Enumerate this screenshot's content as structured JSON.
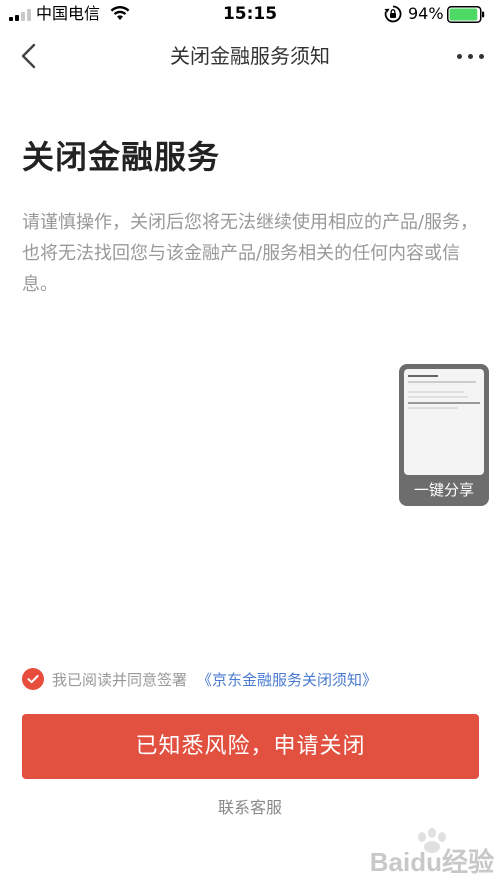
{
  "status_bar": {
    "carrier": "中国电信",
    "time": "15:15",
    "battery_percent": "94%",
    "battery_level": 0.94,
    "icons": [
      "signal-icon",
      "wifi-icon",
      "orientation-lock-icon",
      "battery-icon"
    ]
  },
  "nav": {
    "title": "关闭金融服务须知",
    "back_icon": "chevron-left-icon",
    "more_icon": "more-dots-icon"
  },
  "main": {
    "title": "关闭金融服务",
    "description": "请谨慎操作，关闭后您将无法继续使用相应的产品/服务，也将无法找回您与该金融产品/服务相关的任何内容或信息。"
  },
  "share_widget": {
    "label": "一键分享"
  },
  "agreement": {
    "checked": true,
    "text": "我已阅读并同意签署",
    "link_text": "《京东金融服务关闭须知》"
  },
  "actions": {
    "primary_label": "已知悉风险，申请关闭",
    "contact_label": "联系客服"
  },
  "colors": {
    "accent": "#e25040",
    "link": "#4a7bd1",
    "battery": "#4cd964"
  },
  "watermark": {
    "text": "Baidu经验"
  }
}
